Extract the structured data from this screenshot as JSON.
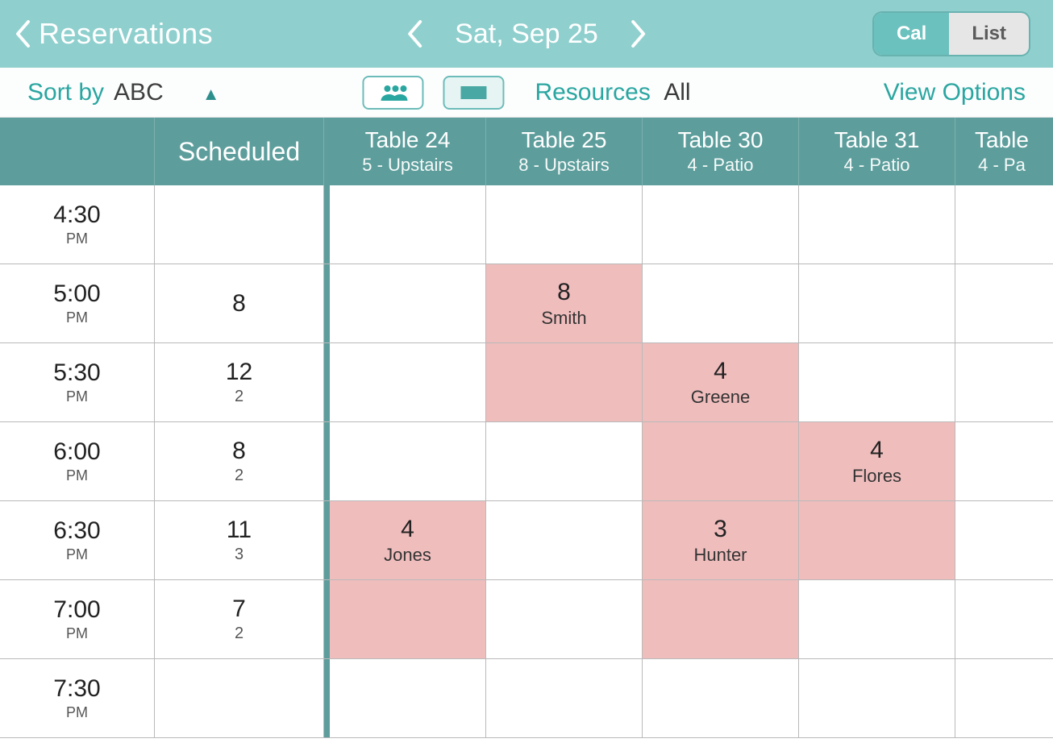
{
  "nav": {
    "back_label": "Reservations",
    "date_label": "Sat, Sep 25",
    "toggle": {
      "cal": "Cal",
      "list": "List"
    }
  },
  "toolbar": {
    "sort_label": "Sort by",
    "sort_value": "ABC",
    "resources_label": "Resources",
    "resources_value": "All",
    "view_options": "View Options"
  },
  "columns": {
    "scheduled": "Scheduled",
    "tables": [
      {
        "title": "Table 24",
        "sub": "5 - Upstairs"
      },
      {
        "title": "Table 25",
        "sub": "8 - Upstairs"
      },
      {
        "title": "Table 30",
        "sub": "4 - Patio"
      },
      {
        "title": "Table 31",
        "sub": "4 - Patio"
      },
      {
        "title": "Table",
        "sub": "4 - Pa"
      }
    ]
  },
  "rows": [
    {
      "time": "4:30",
      "ampm": "PM",
      "scheduled": {
        "count": "",
        "sub": ""
      },
      "cells": [
        {},
        {},
        {},
        {},
        {}
      ]
    },
    {
      "time": "5:00",
      "ampm": "PM",
      "scheduled": {
        "count": "8",
        "sub": ""
      },
      "cells": [
        {},
        {
          "party": "8",
          "guest": "Smith",
          "res": true
        },
        {},
        {},
        {}
      ]
    },
    {
      "time": "5:30",
      "ampm": "PM",
      "scheduled": {
        "count": "12",
        "sub": "2"
      },
      "cells": [
        {},
        {
          "res": true
        },
        {
          "party": "4",
          "guest": "Greene",
          "res": true
        },
        {},
        {}
      ]
    },
    {
      "time": "6:00",
      "ampm": "PM",
      "scheduled": {
        "count": "8",
        "sub": "2"
      },
      "cells": [
        {},
        {},
        {
          "res": true
        },
        {
          "party": "4",
          "guest": "Flores",
          "res": true
        },
        {}
      ]
    },
    {
      "time": "6:30",
      "ampm": "PM",
      "scheduled": {
        "count": "11",
        "sub": "3"
      },
      "cells": [
        {
          "party": "4",
          "guest": "Jones",
          "res": true
        },
        {},
        {
          "party": "3",
          "guest": "Hunter",
          "res": true
        },
        {
          "res": true
        },
        {}
      ]
    },
    {
      "time": "7:00",
      "ampm": "PM",
      "scheduled": {
        "count": "7",
        "sub": "2"
      },
      "cells": [
        {
          "res": true
        },
        {},
        {
          "res": true
        },
        {},
        {}
      ]
    },
    {
      "time": "7:30",
      "ampm": "PM",
      "scheduled": {
        "count": "",
        "sub": ""
      },
      "cells": [
        {},
        {},
        {},
        {},
        {}
      ]
    }
  ]
}
